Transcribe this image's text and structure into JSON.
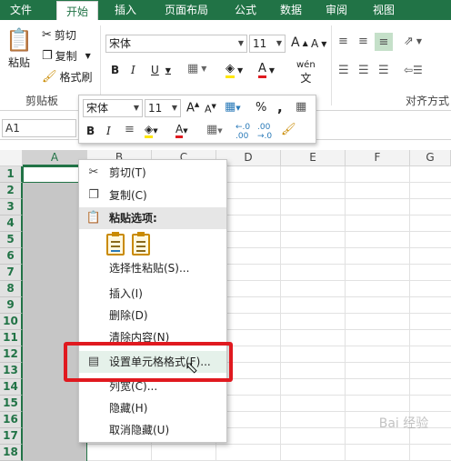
{
  "tabs": [
    "文件",
    "开始",
    "插入",
    "页面布局",
    "公式",
    "数据",
    "审阅",
    "视图"
  ],
  "active_tab": "开始",
  "ribbon": {
    "clipboard": {
      "paste": "粘贴",
      "cut": "剪切",
      "copy": "复制",
      "format_painter": "格式刷",
      "group_label": "剪贴板"
    },
    "font": {
      "name": "宋体",
      "size": "11",
      "bold": "B",
      "italic": "I",
      "underline": "U",
      "grow": "A",
      "shrink": "A",
      "wen": "wén"
    },
    "alignment_label": "对齐方式"
  },
  "formula_bar": {
    "name_box": "A1"
  },
  "columns": [
    "A",
    "B",
    "C",
    "D",
    "E",
    "F",
    "G"
  ],
  "rows": [
    "1",
    "2",
    "3",
    "4",
    "5",
    "6",
    "7",
    "8",
    "9",
    "10",
    "11",
    "12",
    "13",
    "14",
    "15",
    "16",
    "17",
    "18"
  ],
  "mini_toolbar": {
    "font": "宋体",
    "size": "11",
    "bold": "B",
    "italic": "I",
    "percent": "%",
    "comma": ","
  },
  "context_menu": {
    "items": [
      {
        "label": "剪切(T)",
        "icon": "scissors-icon"
      },
      {
        "label": "复制(C)",
        "icon": "copy-icon"
      },
      {
        "label": "粘贴选项:",
        "icon": "paste-icon"
      },
      {
        "label": "选择性粘贴(S)...",
        "icon": ""
      },
      {
        "label": "插入(I)",
        "icon": ""
      },
      {
        "label": "删除(D)",
        "icon": ""
      },
      {
        "label": "清除内容(N)",
        "icon": ""
      },
      {
        "label": "设置单元格格式(F)...",
        "icon": "format-cells-icon"
      },
      {
        "label": "列宽(C)...",
        "icon": ""
      },
      {
        "label": "隐藏(H)",
        "icon": ""
      },
      {
        "label": "取消隐藏(U)",
        "icon": ""
      }
    ]
  },
  "accent_color": "#217346",
  "highlight_color": "#e0191f",
  "watermark": "Bai 经验"
}
